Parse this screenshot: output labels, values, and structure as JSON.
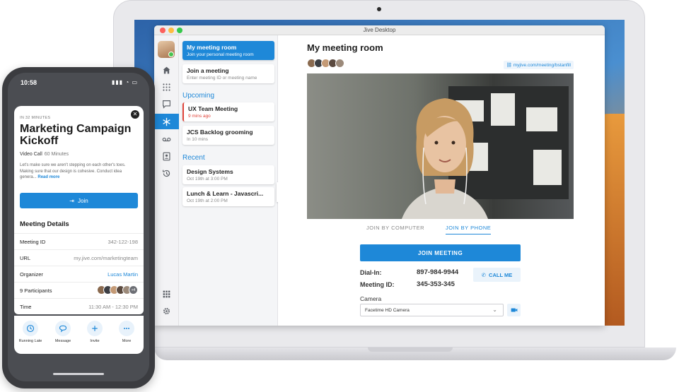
{
  "desktop": {
    "window_title": "Jive Desktop",
    "list": {
      "primary": {
        "title": "My meeting room",
        "subtitle": "Join your personal meeting room"
      },
      "join": {
        "title": "Join a meeting",
        "subtitle": "Enter meeting ID or meeting name"
      },
      "upcoming_label": "Upcoming",
      "upcoming": [
        {
          "title": "UX Team Meeting",
          "subtitle": "9 mins ago",
          "alert": true
        },
        {
          "title": "JCS Backlog grooming",
          "subtitle": "In 10 mins",
          "alert": false
        }
      ],
      "recent_label": "Recent",
      "recent": [
        {
          "title": "Design Systems",
          "subtitle": "Oct 19th at 3:00 PM"
        },
        {
          "title": "Lunch & Learn - Javascri...",
          "subtitle": "Oct 19th at 2:00 PM"
        }
      ]
    },
    "main": {
      "title": "My meeting room",
      "room_link": "myjive.com/meeting/bstanfill",
      "tab_computer": "JOIN BY COMPUTER",
      "tab_phone": "JOIN BY PHONE",
      "join_button": "JOIN MEETING",
      "dialin_label": "Dial-In:",
      "dialin_value": "897-984-9944",
      "meetingid_label": "Meeting ID:",
      "meetingid_value": "345-353-345",
      "call_me": "CALL ME",
      "camera_label": "Camera",
      "camera_value": "Facetime HD Camera"
    },
    "rail_icons": [
      "home-icon",
      "dialpad-icon",
      "chat-icon",
      "meetings-icon",
      "voicemail-icon",
      "contacts-icon",
      "history-icon",
      "apps-icon",
      "settings-icon"
    ],
    "accent": "#1e88d8",
    "alert_color": "#e0443a"
  },
  "phone": {
    "time": "10:58",
    "eyebrow": "IN 32 MINUTES",
    "title": "Marketing Campaign Kickoff",
    "kind": "Video Call",
    "duration": "60 Minutes",
    "description": "Let's make sure we aren't stepping on each other's toes. Making sure that our design is cohesive. Conduct idea genera...",
    "read_more": "Read more",
    "join": "Join",
    "details_heading": "Meeting Details",
    "rows": [
      {
        "key": "Meeting ID",
        "value": "342-122-198"
      },
      {
        "key": "URL",
        "value": "my.jive.com/marketingteam"
      },
      {
        "key": "Organizer",
        "value": "Lucas Martin"
      },
      {
        "key": "9 Participants",
        "value": "+4"
      },
      {
        "key": "Time",
        "value": "11:30 AM - 12:30 PM"
      }
    ],
    "actions": [
      {
        "label": "Running Late",
        "icon": "clock-icon"
      },
      {
        "label": "Message",
        "icon": "message-icon"
      },
      {
        "label": "Invite",
        "icon": "plus-icon"
      },
      {
        "label": "More",
        "icon": "more-icon"
      }
    ]
  }
}
